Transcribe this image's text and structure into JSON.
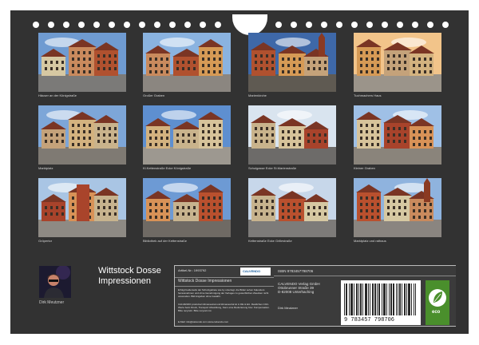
{
  "colors": {
    "page": "#323232",
    "info_panel": "#3b3b3b",
    "eco_badge": "#4a8f2c"
  },
  "photos": [
    {
      "caption": "Häuser an der Königstraße"
    },
    {
      "caption": "Großer Graben"
    },
    {
      "caption": "Marienkirche"
    },
    {
      "caption": "Tuchmachers Haus"
    },
    {
      "caption": "Marktplatz"
    },
    {
      "caption": "Kl.Kettenstraße Ecke Königstraße"
    },
    {
      "caption": "Schulgasse Ecke St.Marienstraße"
    },
    {
      "caption": "Kleiner Graben"
    },
    {
      "caption": "Gröpertor"
    },
    {
      "caption": "Bibliothek auf der Kettenstraße"
    },
    {
      "caption": "Kettenstraße Ecke Grillestraße"
    },
    {
      "caption": "Marktplatz und rathaus"
    }
  ],
  "author": {
    "name": "Dirk Meutzner",
    "photo_icon": "portrait-icon"
  },
  "calendar_title": "Wittstock Dosse Impressionen",
  "info": {
    "article_no": "Artikel-Nr.: 1993792",
    "calvendo_logo": "CALVENDO",
    "subtitle": "Wittstock Dosse Impressionen",
    "description": "Erfolgt beiderseits der Schutzgebiete wie by unterlegt. die Bilder sehen Kalenders herausnehmen und ohne Genehmigung der Verlages zu gewerblichen Zwecken nicht verwenden. Bild Angaben ohne Gewähr.",
    "description2": "CALVENDO produziert klimaneutral und klimaneutral ist in DE & EU. Restlichen CO2-Werte beim Druck, Transport Abwicklung, Kann eine Reduzierung bzw. Kompensation. Bitte recyceln. Bitte recyceln ist.",
    "email": "E-Mail: info@calvendo.com  www.calvendo.com",
    "isbn": "ISBN 9783457798706",
    "publisher": [
      "CALVENDO Verlag GmbH",
      "Ottobrunner Straße 39",
      "D-82008 Unterhaching"
    ],
    "author_small": "Dirk Meutzner",
    "barcode_number": "9 783457 798706",
    "eco_label": "eco"
  }
}
